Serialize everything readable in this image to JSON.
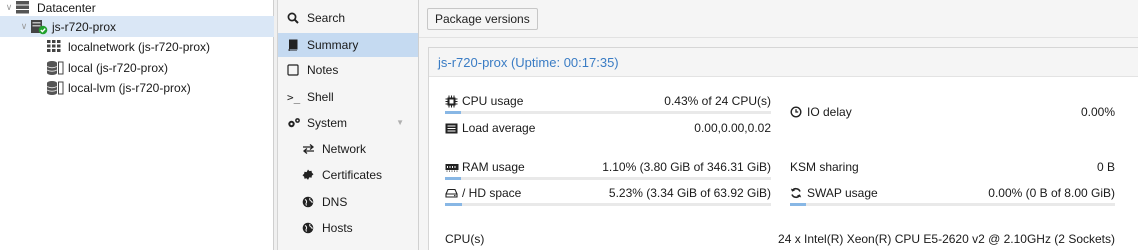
{
  "tree": {
    "datacenter": "Datacenter",
    "node": "js-r720-prox",
    "children": [
      {
        "label": "localnetwork (js-r720-prox)",
        "icon": "network-grid-icon"
      },
      {
        "label": "local (js-r720-prox)",
        "icon": "storage-icon"
      },
      {
        "label": "local-lvm (js-r720-prox)",
        "icon": "storage-icon"
      }
    ]
  },
  "nav": {
    "search": "Search",
    "summary": "Summary",
    "notes": "Notes",
    "shell": "Shell",
    "system": "System",
    "network": "Network",
    "certificates": "Certificates",
    "dns": "DNS",
    "hosts": "Hosts"
  },
  "toolbar": {
    "package_versions": "Package versions"
  },
  "summary": {
    "title": "js-r720-prox (Uptime: 00:17:35)",
    "cpu_usage": {
      "label": "CPU usage",
      "value": "0.43% of 24 CPU(s)",
      "fraction": 0.0043
    },
    "load_average": {
      "label": "Load average",
      "value": "0.00,0.00,0.02"
    },
    "io_delay": {
      "label": "IO delay",
      "value": "0.00%"
    },
    "ram_usage": {
      "label": "RAM usage",
      "value": "1.10% (3.80 GiB of 346.31 GiB)",
      "fraction": 0.011
    },
    "ksm_sharing": {
      "label": "KSM sharing",
      "value": "0 B"
    },
    "hd_space": {
      "label": "/ HD space",
      "value": "5.23% (3.34 GiB of 63.92 GiB)",
      "fraction": 0.0523
    },
    "swap_usage": {
      "label": "SWAP usage",
      "value": "0.00% (0 B of 8.00 GiB)",
      "fraction": 0.0
    },
    "cpus": {
      "label": "CPU(s)",
      "value": "24 x Intel(R) Xeon(R) CPU E5-2620 v2 @ 2.10GHz (2 Sockets)"
    }
  },
  "colors": {
    "accent": "#3a7cc4",
    "selection": "#c5daf1",
    "bar": "#88b7e5",
    "ok": "#21a12e"
  }
}
